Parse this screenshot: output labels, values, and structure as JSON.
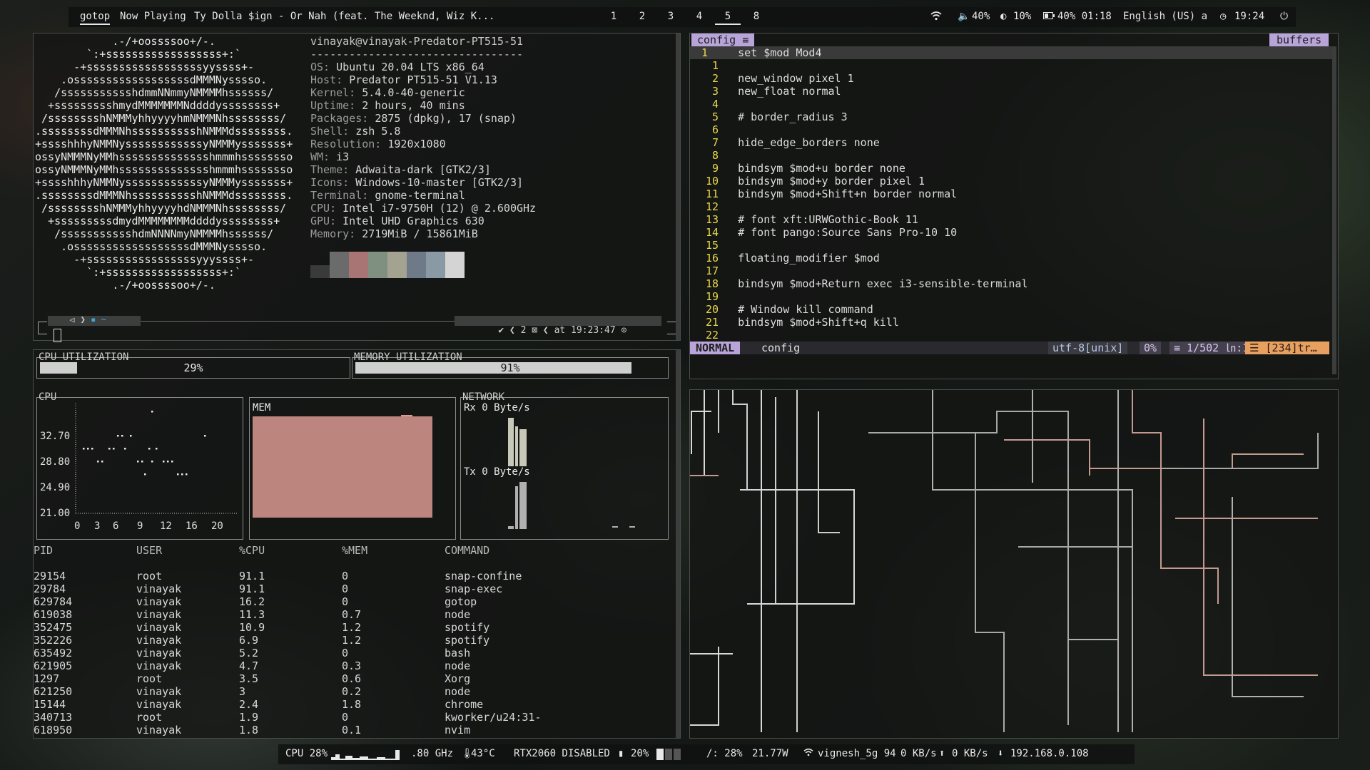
{
  "topbar": {
    "tabs": [
      "gotop",
      "Now Playing",
      "Ty Dolla $ign - Or Nah (feat. The Weeknd, Wiz K..."
    ],
    "workspaces": [
      "1",
      "2",
      "3",
      "4",
      "5",
      "8"
    ],
    "active_workspace": "5",
    "volume": "40%",
    "brightness": "10%",
    "battery": "40% 01:18",
    "keyboard": "English (US) a",
    "clock": "19:24"
  },
  "neofetch": {
    "logo": [
      "            .-/+oossssoo+/-.",
      "        `:+ssssssssssssssssss+:`",
      "      -+ssssssssssssssssssyyssss+-",
      "    .ossssssssssssssssssdMMMNysssso.",
      "   /ssssssssssshdmmNNmmyNMMMMhssssss/",
      "  +ssssssssshmydMMMMMMMNddddyssssssss+",
      " /sssssssshNMMMyhhyyyyhmNMMMNhssssssss/",
      ".ssssssssdMMMNhsssssssssshNMMMdssssssss.",
      "+sssshhhyNMMNyssssssssssssyNMMMysssssss+",
      "ossyNMMMNyMMhsssssssssssssshmmmhssssssso",
      "ossyNMMMNyMMhsssssssssssssshmmmhssssssso",
      "+sssshhhyNMMNyssssssssssssyNMMMysssssss+",
      ".ssssssssdMMMNhsssssssssshNMMMdssssssss.",
      " /sssssssshNMMMyhhyyyyhdNMMMNhssssssss/",
      "  +sssssssssdmydMMMMMMMMddddyssssssss+",
      "   /ssssssssssshdmNNNNmyNMMMMhssssss/",
      "    .ossssssssssssssssssdMMMNysssso.",
      "      -+sssssssssssssssssyyyssss+-",
      "        `:+ssssssssssssssssss+:`",
      "            .-/+oossssoo+/-."
    ],
    "user": "vinayak@vinayak-Predator-PT515-51",
    "separator": "---------------------------------",
    "info": [
      {
        "k": "OS",
        "v": "Ubuntu 20.04 LTS x86_64"
      },
      {
        "k": "Host",
        "v": "Predator PT515-51 V1.13"
      },
      {
        "k": "Kernel",
        "v": "5.4.0-40-generic"
      },
      {
        "k": "Uptime",
        "v": "2 hours, 40 mins"
      },
      {
        "k": "Packages",
        "v": "2875 (dpkg), 17 (snap)"
      },
      {
        "k": "Shell",
        "v": "zsh 5.8"
      },
      {
        "k": "Resolution",
        "v": "1920x1080"
      },
      {
        "k": "WM",
        "v": "i3"
      },
      {
        "k": "Theme",
        "v": "Adwaita-dark [GTK2/3]"
      },
      {
        "k": "Icons",
        "v": "Windows-10-master [GTK2/3]"
      },
      {
        "k": "Terminal",
        "v": "gnome-terminal"
      },
      {
        "k": "CPU",
        "v": "Intel i7-9750H (12) @ 2.600GHz"
      },
      {
        "k": "GPU",
        "v": "Intel UHD Graphics 630"
      },
      {
        "k": "Memory",
        "v": "2719MiB / 15861MiB"
      }
    ],
    "palette": [
      "#3a3a3a",
      "#6b6b6b",
      "#a87474",
      "#7f9080",
      "#a4a290",
      "#6f7a88",
      "#8a9aa4",
      "#d4d4d4"
    ],
    "prompt_right": "✔ ❮ 2 ⊠ ❮ at 19:23:47 ⊙"
  },
  "vim": {
    "tab": "config ≡",
    "buffers_label": "buffers",
    "lines": [
      {
        "n": "1",
        "t": "set $mod Mod4"
      },
      {
        "n": "1",
        "t": ""
      },
      {
        "n": "2",
        "t": "new_window pixel 1"
      },
      {
        "n": "3",
        "t": "new_float normal"
      },
      {
        "n": "4",
        "t": ""
      },
      {
        "n": "5",
        "t": "# border_radius 3"
      },
      {
        "n": "6",
        "t": ""
      },
      {
        "n": "7",
        "t": "hide_edge_borders none"
      },
      {
        "n": "8",
        "t": ""
      },
      {
        "n": "9",
        "t": "bindsym $mod+u border none"
      },
      {
        "n": "10",
        "t": "bindsym $mod+y border pixel 1"
      },
      {
        "n": "11",
        "t": "bindsym $mod+Shift+n border normal"
      },
      {
        "n": "12",
        "t": ""
      },
      {
        "n": "13",
        "t": "# font xft:URWGothic-Book 11"
      },
      {
        "n": "14",
        "t": "# font pango:Source Sans Pro-10 10"
      },
      {
        "n": "15",
        "t": ""
      },
      {
        "n": "16",
        "t": "floating_modifier $mod"
      },
      {
        "n": "17",
        "t": ""
      },
      {
        "n": "18",
        "t": "bindsym $mod+Return exec i3-sensible-terminal"
      },
      {
        "n": "19",
        "t": ""
      },
      {
        "n": "20",
        "t": "# Window kill command"
      },
      {
        "n": "21",
        "t": "bindsym $mod+Shift+q kill"
      },
      {
        "n": "22",
        "t": ""
      }
    ],
    "status": {
      "mode": "NORMAL",
      "file": "config",
      "encoding": "utf-8[unix]",
      "percent": "0%",
      "position": "≡ 1/502 ㏑:1",
      "trailing": "☰ [234]tr…"
    }
  },
  "gotop": {
    "cpu_util_title": "CPU UTILIZATION",
    "cpu_util_value": "29%",
    "cpu_util_fraction": 0.29,
    "mem_util_title": "MEMORY UTILIZATION",
    "mem_util_value": "91%",
    "mem_util_fraction": 0.91,
    "cpu_title": "CPU",
    "cpu_yticks": [
      "32.70",
      "28.80",
      "24.90",
      "21.00"
    ],
    "cpu_xticks": [
      "0",
      "3",
      "6",
      "9",
      "12",
      "16",
      "20"
    ],
    "mem_title": "MEM",
    "net_title": "NETWORK",
    "rx": "Rx 0 Byte/s",
    "tx": "Tx 0 Byte/s",
    "proc_headers": [
      "PID",
      "USER",
      "%CPU",
      "%MEM",
      "COMMAND"
    ],
    "procs": [
      [
        "29154",
        "root",
        "91.1",
        "0",
        "snap-confine"
      ],
      [
        "29784",
        "vinayak",
        "91.1",
        "0",
        "snap-exec"
      ],
      [
        "629784",
        "vinayak",
        "16.2",
        "0",
        "gotop"
      ],
      [
        "619038",
        "vinayak",
        "11.3",
        "0.7",
        "node"
      ],
      [
        "352475",
        "vinayak",
        "10.9",
        "1.2",
        "spotify"
      ],
      [
        "352226",
        "vinayak",
        "6.9",
        "1.2",
        "spotify"
      ],
      [
        "635492",
        "vinayak",
        "5.2",
        "0",
        "bash"
      ],
      [
        "621905",
        "vinayak",
        "4.7",
        "0.3",
        "node"
      ],
      [
        "1297",
        "root",
        "3.5",
        "0.6",
        "Xorg"
      ],
      [
        "621250",
        "vinayak",
        "3",
        "0.2",
        "node"
      ],
      [
        "15144",
        "vinayak",
        "2.4",
        "1.8",
        "chrome"
      ],
      [
        "340713",
        "root",
        "1.9",
        "0",
        "kworker/u24:31-"
      ],
      [
        "618950",
        "vinayak",
        "1.8",
        "0.1",
        "nvim"
      ]
    ]
  },
  "bottombar": {
    "cpu": "CPU 28%",
    "freq": ".80 GHz",
    "temp": "43°C",
    "gpu": "RTX2060 DISABLED",
    "mem": "20%",
    "disk": "/: 28%",
    "power": "21.77W",
    "wifi": "vignesh_5g 94",
    "down": "0 KB/s",
    "up": "0 KB/s",
    "ip": "192.168.0.108"
  }
}
